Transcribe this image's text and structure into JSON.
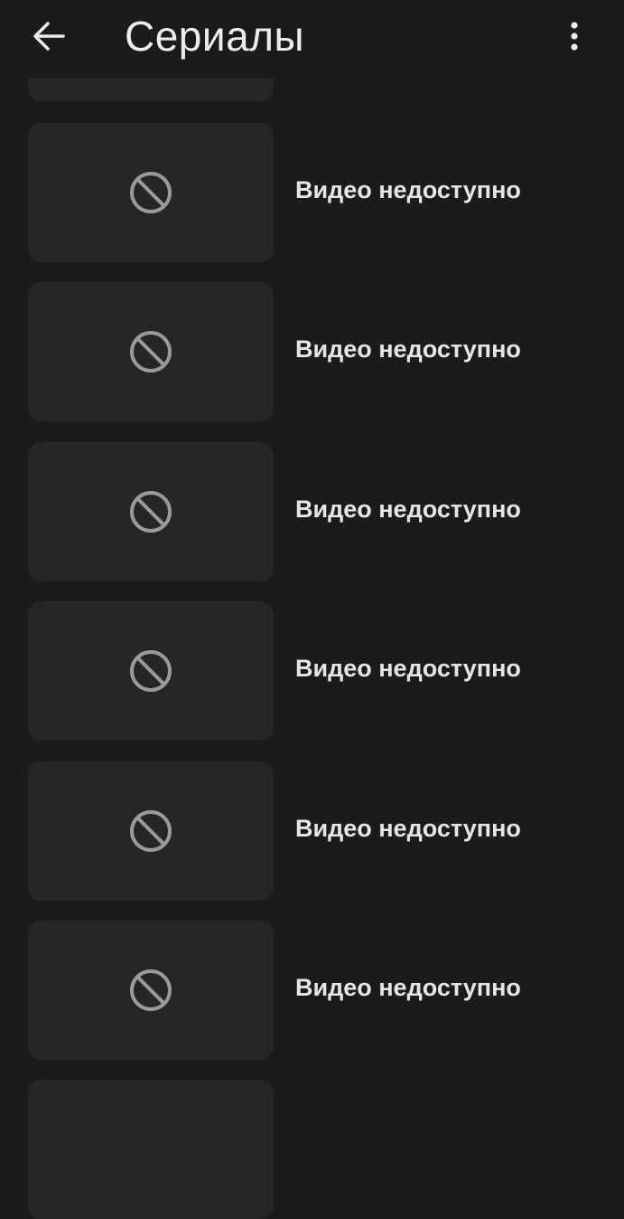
{
  "header": {
    "title": "Сериалы",
    "back_icon": "arrow-left-icon",
    "menu_icon": "more-vert-icon"
  },
  "items": [
    {
      "title": "Видео недоступно",
      "thumb_icon": "block-icon"
    },
    {
      "title": "Видео недоступно",
      "thumb_icon": "block-icon"
    },
    {
      "title": "Видео недоступно",
      "thumb_icon": "block-icon"
    },
    {
      "title": "Видео недоступно",
      "thumb_icon": "block-icon"
    },
    {
      "title": "Видео недоступно",
      "thumb_icon": "block-icon"
    },
    {
      "title": "Видео недоступно",
      "thumb_icon": "block-icon"
    }
  ],
  "colors": {
    "background": "#1b1b1b",
    "thumbnail": "#262626",
    "text": "#e6e6e6",
    "icon": "#9a9a9a"
  }
}
